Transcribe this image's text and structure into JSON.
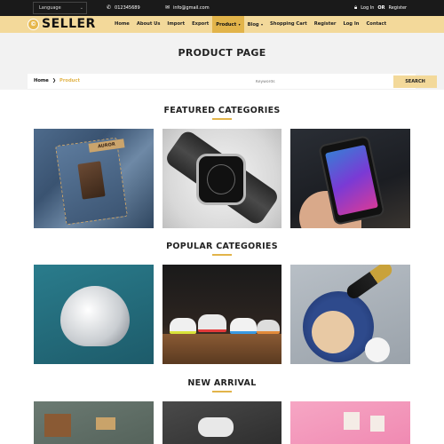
{
  "topbar": {
    "language_label": "Language",
    "phone": "012345689",
    "email": "info@gmail.com",
    "login_text": "Log In",
    "or_text": "OR",
    "register_text": "Register"
  },
  "logo": {
    "mark": "©",
    "text": "SELLER"
  },
  "nav": {
    "items": [
      "Home",
      "About Us",
      "Import",
      "Export",
      "Product",
      "Blog",
      "Shopping Cart",
      "Register",
      "Log In",
      "Contact"
    ],
    "active": "Product"
  },
  "page": {
    "title": "PRODUCT PAGE"
  },
  "breadcrumb": {
    "home": "Home",
    "current": "Product"
  },
  "search": {
    "placeholder": "Keywords",
    "button": "SEARCH"
  },
  "sections": {
    "featured": "FEATURED CATEGORIES",
    "popular": "POPULAR CATEGORIES",
    "new_arrival": "NEW ARRIVAL"
  },
  "tile_labels": {
    "jeans_tag": "AUROR"
  },
  "colors": {
    "accent": "#e2b44a",
    "nav_bg": "#f3d99a",
    "topbar_bg": "#1a1a1a"
  }
}
